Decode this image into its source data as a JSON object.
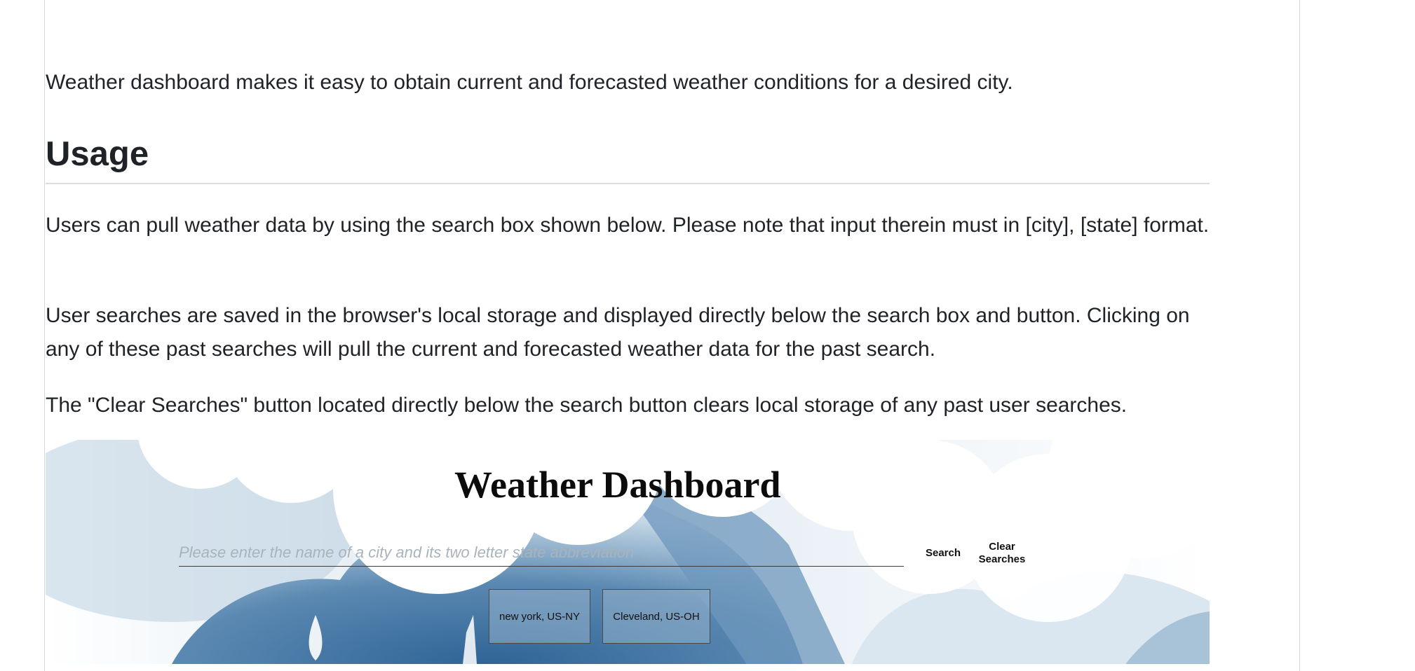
{
  "intro": {
    "text": "Weather dashboard makes it easy to obtain current and forecasted weather conditions for a desired city."
  },
  "usage": {
    "heading": "Usage",
    "paragraphs": [
      "Users can pull weather data by using the search box shown below. Please note that input therein must in [city], [state] format.",
      "User searches are saved in the browser's local storage and displayed directly below the search box and button. Clicking on any of these past searches will pull the current and forecasted weather data for the past search.",
      "The \"Clear Searches\" button located directly below the search button clears local storage of any past user searches."
    ]
  },
  "screenshot": {
    "title": "Weather Dashboard",
    "search": {
      "placeholder": "Please enter the name of a city and its two letter state abbreviation",
      "value": ""
    },
    "search_button": "Search",
    "clear_button": "Clear Searches",
    "history": [
      "new york, US-NY",
      "Cleveland, US-OH"
    ]
  },
  "colors": {
    "sky_blue": "#4f7ea8",
    "light_blue": "#a9c3d8",
    "text": "#1f2328",
    "border": "#d0d7de"
  }
}
